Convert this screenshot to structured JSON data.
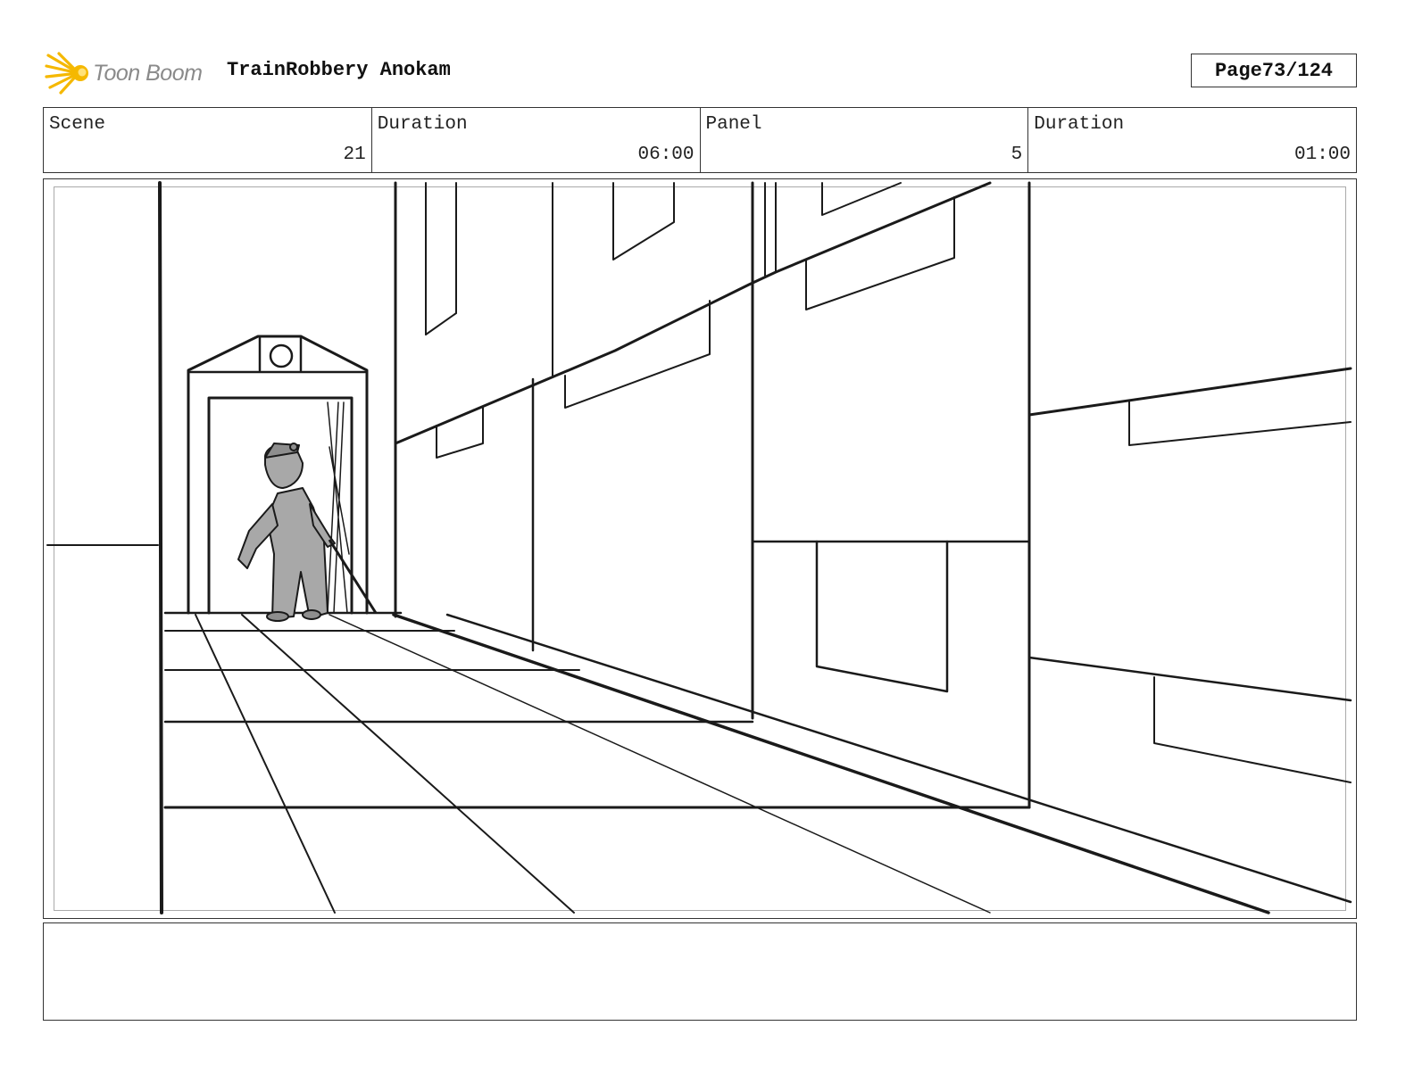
{
  "header": {
    "logo_text": "Toon Boom",
    "project_title": "TrainRobbery Anokam",
    "page_label": "Page",
    "page_value": "73/124"
  },
  "info": {
    "scene_label": "Scene",
    "scene_value": "21",
    "scene_duration_label": "Duration",
    "scene_duration_value": "06:00",
    "panel_label": "Panel",
    "panel_value": "5",
    "panel_duration_label": "Duration",
    "panel_duration_value": "01:00"
  },
  "colors": {
    "logo_star": "#f5b800",
    "logo_text": "#8a8a8a",
    "figure_fill": "#a8a8a8",
    "line": "#1a1a1a"
  }
}
